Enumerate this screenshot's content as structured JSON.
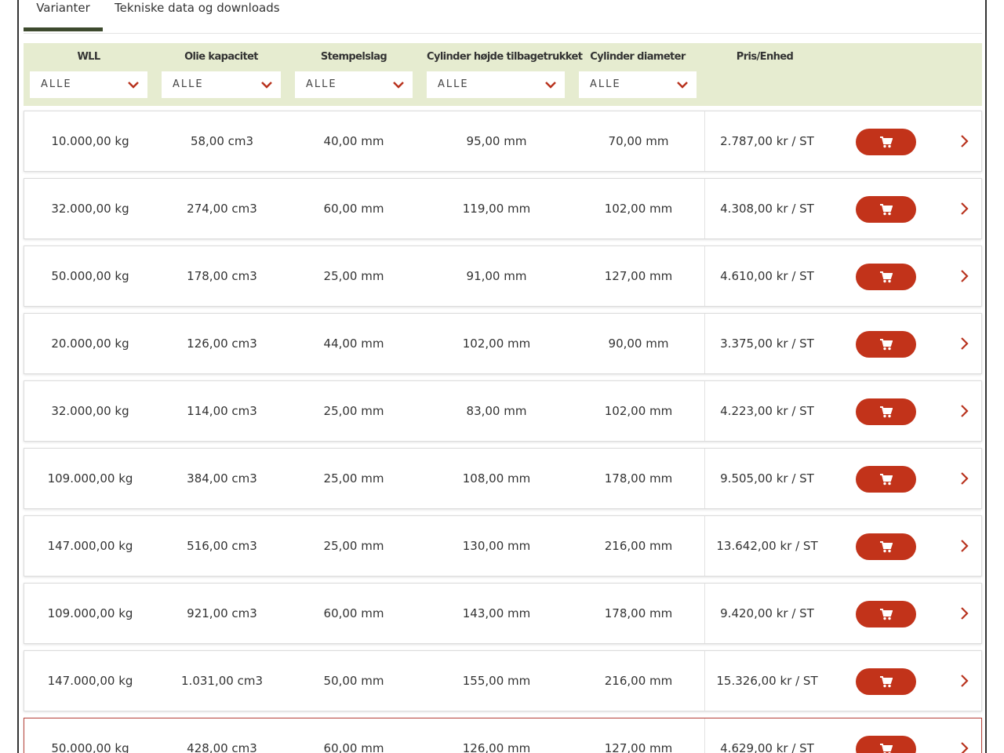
{
  "tabs": [
    {
      "label": "Varianter"
    },
    {
      "label": "Tekniske data og downloads"
    }
  ],
  "filters": {
    "columns": [
      {
        "header": "WLL",
        "value": "ALLE"
      },
      {
        "header": "Olie kapacitet",
        "value": "ALLE"
      },
      {
        "header": "Stempelslag",
        "value": "ALLE"
      },
      {
        "header": "Cylinder højde tilbagetrukket",
        "value": "ALLE"
      },
      {
        "header": "Cylinder diameter",
        "value": "ALLE"
      }
    ],
    "price_header": "Pris/Enhed"
  },
  "rows": [
    {
      "wll": "10.000,00 kg",
      "oil": "58,00 cm3",
      "stroke": "40,00 mm",
      "height": "95,00 mm",
      "diameter": "70,00 mm",
      "price": "2.787,00 kr / ST"
    },
    {
      "wll": "32.000,00 kg",
      "oil": "274,00 cm3",
      "stroke": "60,00 mm",
      "height": "119,00 mm",
      "diameter": "102,00 mm",
      "price": "4.308,00 kr / ST"
    },
    {
      "wll": "50.000,00 kg",
      "oil": "178,00 cm3",
      "stroke": "25,00 mm",
      "height": "91,00 mm",
      "diameter": "127,00 mm",
      "price": "4.610,00 kr / ST"
    },
    {
      "wll": "20.000,00 kg",
      "oil": "126,00 cm3",
      "stroke": "44,00 mm",
      "height": "102,00 mm",
      "diameter": "90,00 mm",
      "price": "3.375,00 kr / ST"
    },
    {
      "wll": "32.000,00 kg",
      "oil": "114,00 cm3",
      "stroke": "25,00 mm",
      "height": "83,00 mm",
      "diameter": "102,00 mm",
      "price": "4.223,00 kr / ST"
    },
    {
      "wll": "109.000,00 kg",
      "oil": "384,00 cm3",
      "stroke": "25,00 mm",
      "height": "108,00 mm",
      "diameter": "178,00 mm",
      "price": "9.505,00 kr / ST"
    },
    {
      "wll": "147.000,00 kg",
      "oil": "516,00 cm3",
      "stroke": "25,00 mm",
      "height": "130,00 mm",
      "diameter": "216,00 mm",
      "price": "13.642,00 kr / ST"
    },
    {
      "wll": "109.000,00 kg",
      "oil": "921,00 cm3",
      "stroke": "60,00 mm",
      "height": "143,00 mm",
      "diameter": "178,00 mm",
      "price": "9.420,00 kr / ST"
    },
    {
      "wll": "147.000,00 kg",
      "oil": "1.031,00 cm3",
      "stroke": "50,00 mm",
      "height": "155,00 mm",
      "diameter": "216,00 mm",
      "price": "15.326,00 kr / ST"
    },
    {
      "wll": "50.000,00 kg",
      "oil": "428,00 cm3",
      "stroke": "60,00 mm",
      "height": "126,00 mm",
      "diameter": "127,00 mm",
      "price": "4.629,00 kr / ST"
    }
  ],
  "icons": {
    "cart": "shopping-cart-icon",
    "row_arrow": "chevron-right-icon",
    "dropdown": "chevron-down-icon"
  },
  "colors": {
    "accent": "#c2331a",
    "filter_bg": "#e6ecd0",
    "tab_underline": "#3d4a2e",
    "highlight_border": "#b8433a"
  }
}
